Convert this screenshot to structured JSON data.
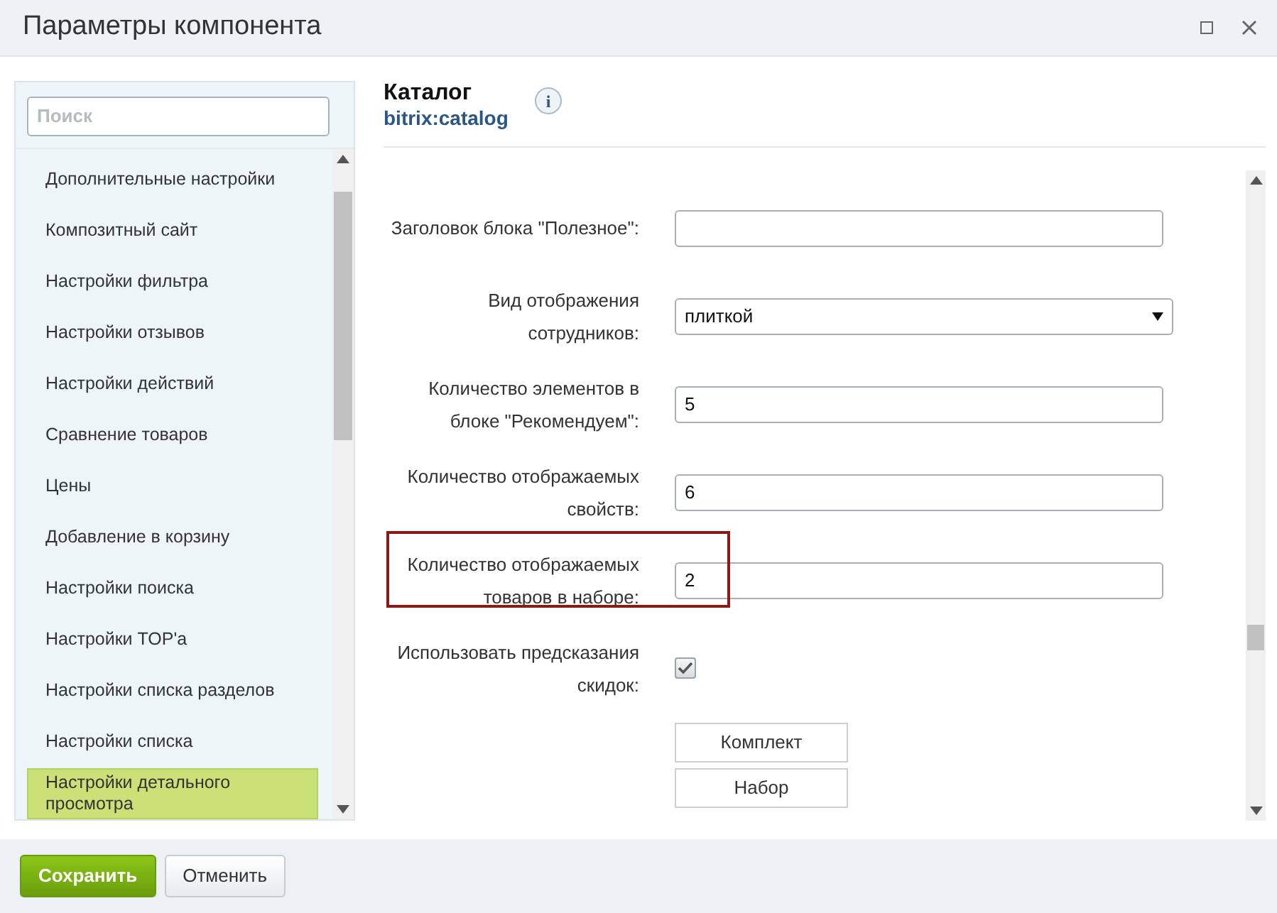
{
  "window": {
    "title": "Параметры компонента"
  },
  "sidebar": {
    "search": {
      "placeholder": "Поиск"
    },
    "items": [
      {
        "label": "Дополнительные настройки",
        "selected": false
      },
      {
        "label": "Композитный сайт",
        "selected": false
      },
      {
        "label": "Настройки фильтра",
        "selected": false
      },
      {
        "label": "Настройки отзывов",
        "selected": false
      },
      {
        "label": "Настройки действий",
        "selected": false
      },
      {
        "label": "Сравнение товаров",
        "selected": false
      },
      {
        "label": "Цены",
        "selected": false
      },
      {
        "label": "Добавление в корзину",
        "selected": false
      },
      {
        "label": "Настройки поиска",
        "selected": false
      },
      {
        "label": "Настройки TOP'а",
        "selected": false
      },
      {
        "label": "Настройки списка разделов",
        "selected": false
      },
      {
        "label": "Настройки списка",
        "selected": false
      },
      {
        "label": "Настройки детального просмотра",
        "selected": true
      }
    ]
  },
  "component": {
    "title": "Каталог",
    "code": "bitrix:catalog",
    "info_icon": "i"
  },
  "fields": [
    {
      "kind": "text",
      "label": "Заголовок блока \"Полезное\":",
      "highlighted": false
    },
    {
      "kind": "select",
      "label": "Вид отображения сотрудников:",
      "value": "плиткой",
      "highlighted": false
    },
    {
      "kind": "text",
      "label": "Количество элементов в блоке \"Рекомендуем\":",
      "value": "5",
      "highlighted": false
    },
    {
      "kind": "text",
      "label": "Количество отображаемых свойств:",
      "value": "6",
      "highlighted": false
    },
    {
      "kind": "text",
      "label": "Количество отображаемых товаров в наборе:",
      "value": "2",
      "highlighted": true
    },
    {
      "kind": "checkbox",
      "label": "Использовать предсказания скидок:",
      "checked": true,
      "highlighted": false
    },
    {
      "kind": "buttons",
      "buttons": [
        "Комплект",
        "Набор"
      ]
    }
  ],
  "footer": {
    "buttons": [
      {
        "label": "Сохранить",
        "kind": "primary"
      },
      {
        "label": "Отменить",
        "kind": "secondary"
      }
    ]
  }
}
